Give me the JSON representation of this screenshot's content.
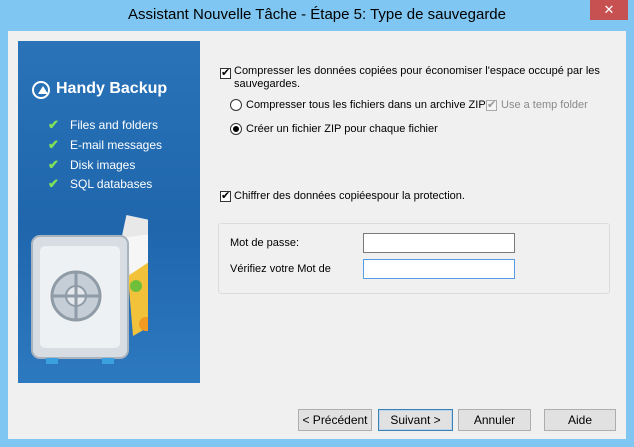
{
  "window": {
    "title": "Assistant Nouvelle Tâche - Étape 5: Type de sauvegarde",
    "close_glyph": "✕"
  },
  "banner": {
    "logo_text": "Handy Backup",
    "features": [
      "Files and folders",
      "E-mail messages",
      "Disk images",
      "SQL databases"
    ]
  },
  "options": {
    "compress_label": "Compresser les données copiées pour économiser l'espace occupé par les sauvegardes.",
    "compress_checked": true,
    "single_zip_label": "Compresser tous les fichiers dans un archive ZIP",
    "temp_folder_label": "Use a temp folder",
    "per_file_zip_label": "Créer un fichier ZIP pour chaque fichier",
    "encrypt_label": "Chiffrer des données copiéespour la protection."
  },
  "password": {
    "password_label": "Mot de passe:",
    "verify_label": "Vérifiez votre Mot de",
    "password_value": "",
    "verify_value": ""
  },
  "buttons": {
    "prev": "< Précédent",
    "next": "Suivant >",
    "cancel": "Annuler",
    "help": "Aide"
  },
  "colors": {
    "titlebar": "#7fc6f2",
    "close": "#c75050",
    "banner": "#1f66ad",
    "check_green": "#7fe05a"
  }
}
